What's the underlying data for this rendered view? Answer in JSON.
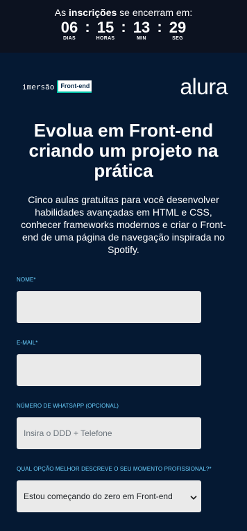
{
  "countdown": {
    "prefix": "As",
    "highlight": "inscrições",
    "suffix": "se encerram em:",
    "units": [
      {
        "value": "06",
        "label": "DIAS"
      },
      {
        "value": "15",
        "label": "HORAS"
      },
      {
        "value": "13",
        "label": "MIN"
      },
      {
        "value": "29",
        "label": "SEG"
      }
    ],
    "separator": ":"
  },
  "brand": {
    "imersao": "imersão",
    "badge": "Front-end",
    "logo": "alura"
  },
  "hero": {
    "title": "Evolua em Front-end criando um projeto na prática",
    "subtitle": "Cinco aulas gratuitas para você desenvolver habilidades avançadas em HTML e CSS, conhecer frameworks modernos e criar o Front-end de uma página de navegação inspirada no Spotify."
  },
  "form": {
    "name": {
      "label": "NOME*",
      "value": "",
      "placeholder": ""
    },
    "email": {
      "label": "E-MAIL*",
      "value": "",
      "placeholder": ""
    },
    "whatsapp": {
      "label": "NÚMERO DE WHATSAPP (OPCIONAL)",
      "value": "",
      "placeholder": "Insira o DDD + Telefone"
    },
    "moment": {
      "label": "QUAL OPÇÃO MELHOR DESCREVE O SEU MOMENTO PROFISSIONAL?*",
      "selected": "Estou começando do zero em Front-end"
    }
  },
  "colors": {
    "page_bg": "#051933",
    "topbar_bg": "#0c1220",
    "label_accent": "#6bd1ff",
    "badge_accent": "#00c2a8",
    "input_bg": "#eaeaea"
  },
  "icons": {
    "select_arrow": "chevron-down-icon"
  }
}
